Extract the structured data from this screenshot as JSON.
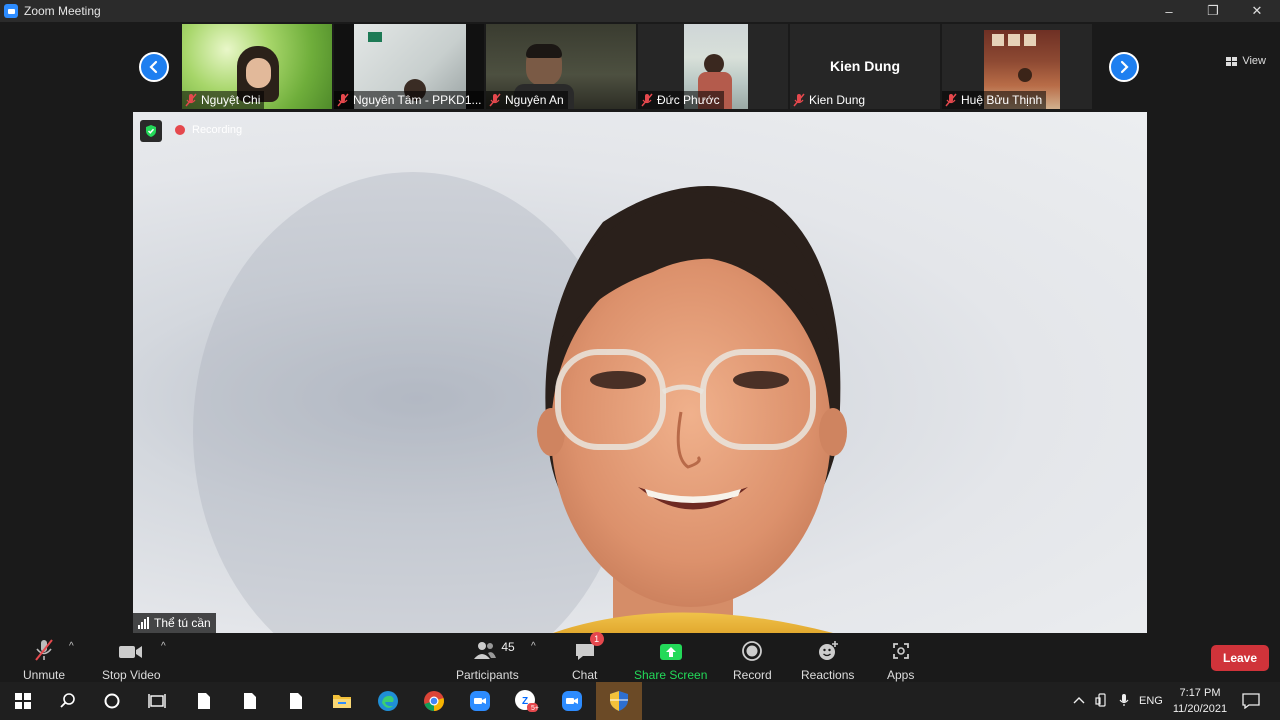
{
  "window": {
    "title": "Zoom Meeting",
    "minimize_icon": "–",
    "restore_icon": "❐",
    "close_icon": "✕"
  },
  "gallery": {
    "participants": [
      {
        "name": "Nguyệt Chi",
        "muted": true,
        "has_video": true
      },
      {
        "name": "Nguyên Tâm - PPKD1...",
        "muted": true,
        "has_video": true
      },
      {
        "name": "Nguyên An",
        "muted": true,
        "has_video": true
      },
      {
        "name": "Đức Phước",
        "muted": true,
        "has_video": true
      },
      {
        "name": "Kien Dung",
        "muted": true,
        "has_video": false,
        "display_name": "Kien Dung"
      },
      {
        "name": "Huệ Bửu Thịnh",
        "muted": true,
        "has_video": true
      }
    ],
    "view_label": "View"
  },
  "main": {
    "recording_label": "Recording",
    "speaker_name": "Thể tú cần"
  },
  "toolbar": {
    "unmute": "Unmute",
    "stop_video": "Stop Video",
    "participants": "Participants",
    "participant_count": "45",
    "chat": "Chat",
    "chat_badge": "1",
    "share_screen": "Share Screen",
    "record": "Record",
    "reactions": "Reactions",
    "apps": "Apps",
    "leave": "Leave",
    "caret": "^"
  },
  "taskbar": {
    "language": "ENG",
    "time": "7:17 PM",
    "date": "11/20/2021",
    "zalo_badge": "5+"
  },
  "colors": {
    "accent_blue": "#2d8cff",
    "share_green": "#23d959",
    "leave_red": "#d0333a",
    "badge_red": "#e5484d"
  }
}
